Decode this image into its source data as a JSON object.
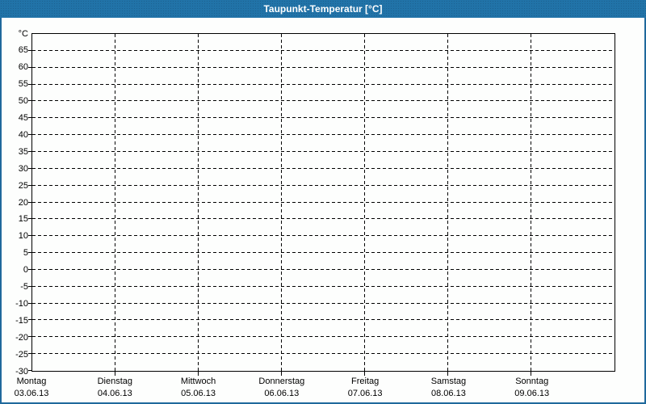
{
  "window": {
    "title": "Taupunkt-Temperatur [°C]"
  },
  "colors": {
    "titlebar": "#2173a8",
    "frame_border": "#1f699c",
    "title_text": "#ffffff",
    "plot_background": "#fdfefd",
    "grid": "#000000",
    "axis_text": "#000000"
  },
  "chart_data": {
    "type": "line",
    "title": "Taupunkt-Temperatur [°C]",
    "note": "empty plot - no data series drawn",
    "grid_style": "dashed",
    "series": [],
    "y_axis": {
      "unit_label": "°C",
      "min": -30,
      "max": 70,
      "tick_step": 5,
      "tick_labels": [
        "65",
        "60",
        "55",
        "50",
        "45",
        "40",
        "35",
        "30",
        "25",
        "20",
        "15",
        "10",
        "5",
        "0",
        "-5",
        "-10",
        "-15",
        "-20",
        "-25",
        "-30"
      ]
    },
    "x_axis": {
      "categories": [
        {
          "day": "Montag",
          "date": "03.06.13"
        },
        {
          "day": "Dienstag",
          "date": "04.06.13"
        },
        {
          "day": "Mittwoch",
          "date": "05.06.13"
        },
        {
          "day": "Donnerstag",
          "date": "06.06.13"
        },
        {
          "day": "Freitag",
          "date": "07.06.13"
        },
        {
          "day": "Samstag",
          "date": "08.06.13"
        },
        {
          "day": "Sonntag",
          "date": "09.06.13"
        }
      ]
    }
  }
}
